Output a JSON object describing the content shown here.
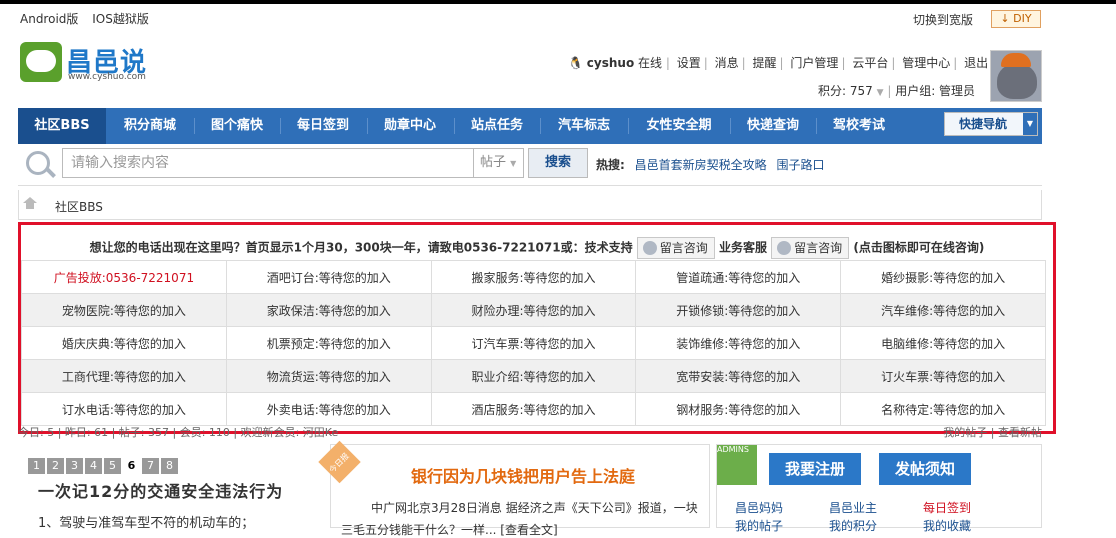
{
  "topbar": {
    "android": "Android版",
    "ios": "IOS越狱版",
    "switch_wide": "切换到宽版",
    "diy": "DIY"
  },
  "logo": {
    "name": "昌邑说",
    "url": "www.cyshuo.com"
  },
  "user": {
    "username": "cyshuo",
    "status": "在线",
    "links": [
      "设置",
      "消息",
      "提醒",
      "门户管理",
      "云平台",
      "管理中心",
      "退出"
    ],
    "points": "积分: 757",
    "group": "用户组: 管理员"
  },
  "nav": {
    "tabs": [
      "社区BBS",
      "积分商城",
      "图个痛快",
      "每日签到",
      "勋章中心",
      "站点任务",
      "汽车标志",
      "女性安全期",
      "快递查询",
      "驾校考试"
    ],
    "quick": "快捷导航"
  },
  "search": {
    "placeholder": "请输入搜索内容",
    "type": "帖子",
    "button": "搜索",
    "hot_label": "热搜:",
    "hot_items": [
      "昌邑首套新房契税全攻略",
      "围子路口"
    ]
  },
  "breadcrumb": {
    "current": "社区BBS"
  },
  "ad": {
    "title_a": "想让您的电话出现在这里吗？首页显示1个月30，300块一年，请致电0536-7221071或：技术支持",
    "consult": "留言咨询",
    "title_b": "业务客服",
    "title_c": "(点击图标即可在线咨询)",
    "rows": [
      [
        "广告投放:0536-7221071",
        "酒吧订台:等待您的加入",
        "搬家服务:等待您的加入",
        "管道疏通:等待您的加入",
        "婚纱摄影:等待您的加入"
      ],
      [
        "宠物医院:等待您的加入",
        "家政保洁:等待您的加入",
        "财险办理:等待您的加入",
        "开锁修锁:等待您的加入",
        "汽车维修:等待您的加入"
      ],
      [
        "婚庆庆典:等待您的加入",
        "机票预定:等待您的加入",
        "订汽车票:等待您的加入",
        "装饰维修:等待您的加入",
        "电脑维修:等待您的加入"
      ],
      [
        "工商代理:等待您的加入",
        "物流货运:等待您的加入",
        "职业介绍:等待您的加入",
        "宽带安装:等待您的加入",
        "订火车票:等待您的加入"
      ],
      [
        "订水电话:等待您的加入",
        "外卖电话:等待您的加入",
        "酒店服务:等待您的加入",
        "钢材服务:等待您的加入",
        "名称待定:等待您的加入"
      ]
    ]
  },
  "stats": {
    "left": "今日: 5 | 昨日: 61 | 帖子: 357 | 会员: 110 | 欢迎新会员: 河田Ke",
    "right": "我的帖子 | 查看新帖"
  },
  "pagination": [
    "1",
    "2",
    "3",
    "4",
    "5",
    "6",
    "7",
    "8"
  ],
  "pagination_current": "6",
  "slide": {
    "slogan": "一次记12分的交通安全违法行为",
    "rule": "1、驾驶与准驾车型不符的机动车的；"
  },
  "news": {
    "ribbon": "今日报",
    "headline": "银行因为几块钱把用户告上法庭",
    "body": "中广网北京3月28日消息 据经济之声《天下公司》报道，一块",
    "body2": "三毛五分钱能干什么？一样...  [查看全文]"
  },
  "side": {
    "badge": "ADMINS",
    "register": "我要注册",
    "post_notice": "发帖须知",
    "links": [
      "昌邑妈妈",
      "昌邑业主",
      "每日签到",
      "我的帖子",
      "我的积分",
      "我的收藏"
    ]
  }
}
